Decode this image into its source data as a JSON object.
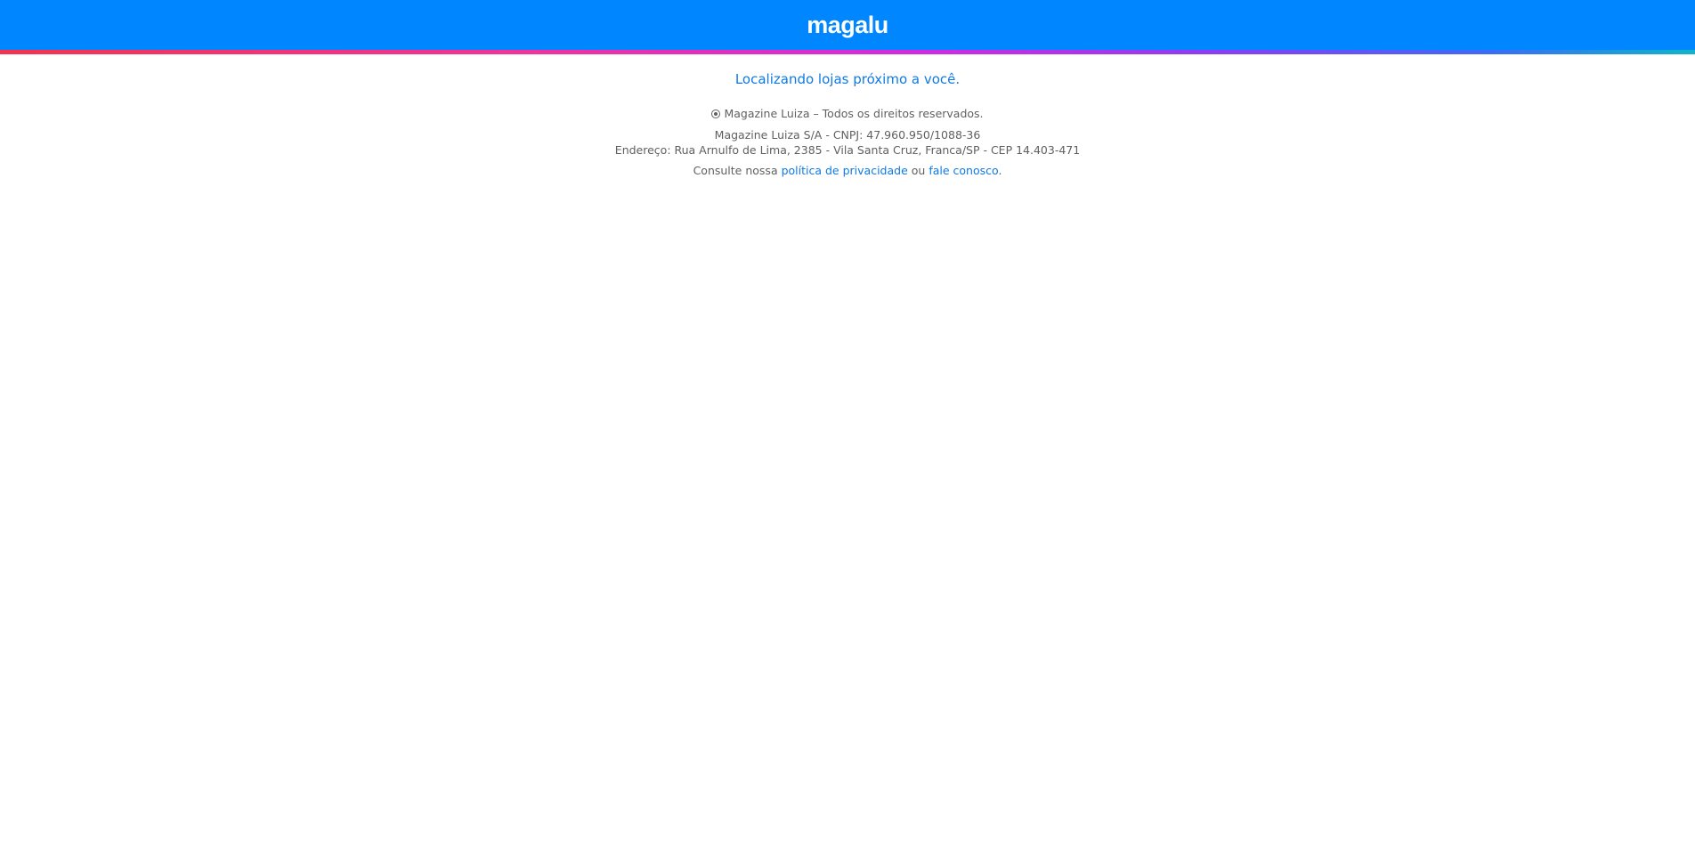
{
  "header": {
    "logo_text": "magalu",
    "background_color": "#0086ff"
  },
  "main": {
    "status_text": "Localizando lojas próximo a você."
  },
  "footer": {
    "copyright_text": "Magazine Luiza – Todos os direitos reservados.",
    "company_line": "Magazine Luiza S/A - CNPJ: 47.960.950/1088-36",
    "address_line": "Endereço: Rua Arnulfo de Lima, 2385 - Vila Santa Cruz, Franca/SP - CEP 14.403-471",
    "consult_prefix": "Consulte nossa",
    "privacy_link": "política de privacidade",
    "connector": "ou",
    "contact_link": "fale conosco",
    "suffix": "."
  },
  "colors": {
    "link": "#0f7ae5",
    "text": "#606060"
  }
}
